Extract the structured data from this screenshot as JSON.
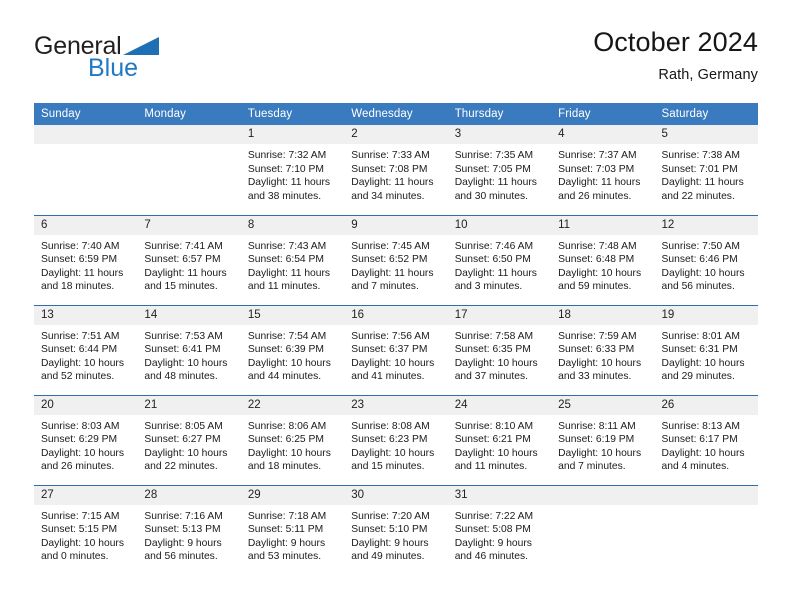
{
  "brand": {
    "line1": "General",
    "line2": "Blue",
    "triangle_icon": "triangle-icon",
    "color_dark": "#231f20",
    "color_blue": "#1f7ac4"
  },
  "header": {
    "title": "October 2024",
    "subtitle": "Rath, Germany"
  },
  "colors": {
    "header_bar": "#3a7bbf",
    "week_divider": "#2f6ead",
    "daynum_band": "#f0f0f0",
    "text": "#1b1b1b"
  },
  "weekday_headers": [
    "Sunday",
    "Monday",
    "Tuesday",
    "Wednesday",
    "Thursday",
    "Friday",
    "Saturday"
  ],
  "weeks": [
    [
      {
        "day": "",
        "empty": true,
        "sunrise": "",
        "sunset": "",
        "daylight_line1": "",
        "daylight_line2": ""
      },
      {
        "day": "",
        "empty": true,
        "sunrise": "",
        "sunset": "",
        "daylight_line1": "",
        "daylight_line2": ""
      },
      {
        "day": "1",
        "empty": false,
        "sunrise": "Sunrise: 7:32 AM",
        "sunset": "Sunset: 7:10 PM",
        "daylight_line1": "Daylight: 11 hours",
        "daylight_line2": "and 38 minutes."
      },
      {
        "day": "2",
        "empty": false,
        "sunrise": "Sunrise: 7:33 AM",
        "sunset": "Sunset: 7:08 PM",
        "daylight_line1": "Daylight: 11 hours",
        "daylight_line2": "and 34 minutes."
      },
      {
        "day": "3",
        "empty": false,
        "sunrise": "Sunrise: 7:35 AM",
        "sunset": "Sunset: 7:05 PM",
        "daylight_line1": "Daylight: 11 hours",
        "daylight_line2": "and 30 minutes."
      },
      {
        "day": "4",
        "empty": false,
        "sunrise": "Sunrise: 7:37 AM",
        "sunset": "Sunset: 7:03 PM",
        "daylight_line1": "Daylight: 11 hours",
        "daylight_line2": "and 26 minutes."
      },
      {
        "day": "5",
        "empty": false,
        "sunrise": "Sunrise: 7:38 AM",
        "sunset": "Sunset: 7:01 PM",
        "daylight_line1": "Daylight: 11 hours",
        "daylight_line2": "and 22 minutes."
      }
    ],
    [
      {
        "day": "6",
        "empty": false,
        "sunrise": "Sunrise: 7:40 AM",
        "sunset": "Sunset: 6:59 PM",
        "daylight_line1": "Daylight: 11 hours",
        "daylight_line2": "and 18 minutes."
      },
      {
        "day": "7",
        "empty": false,
        "sunrise": "Sunrise: 7:41 AM",
        "sunset": "Sunset: 6:57 PM",
        "daylight_line1": "Daylight: 11 hours",
        "daylight_line2": "and 15 minutes."
      },
      {
        "day": "8",
        "empty": false,
        "sunrise": "Sunrise: 7:43 AM",
        "sunset": "Sunset: 6:54 PM",
        "daylight_line1": "Daylight: 11 hours",
        "daylight_line2": "and 11 minutes."
      },
      {
        "day": "9",
        "empty": false,
        "sunrise": "Sunrise: 7:45 AM",
        "sunset": "Sunset: 6:52 PM",
        "daylight_line1": "Daylight: 11 hours",
        "daylight_line2": "and 7 minutes."
      },
      {
        "day": "10",
        "empty": false,
        "sunrise": "Sunrise: 7:46 AM",
        "sunset": "Sunset: 6:50 PM",
        "daylight_line1": "Daylight: 11 hours",
        "daylight_line2": "and 3 minutes."
      },
      {
        "day": "11",
        "empty": false,
        "sunrise": "Sunrise: 7:48 AM",
        "sunset": "Sunset: 6:48 PM",
        "daylight_line1": "Daylight: 10 hours",
        "daylight_line2": "and 59 minutes."
      },
      {
        "day": "12",
        "empty": false,
        "sunrise": "Sunrise: 7:50 AM",
        "sunset": "Sunset: 6:46 PM",
        "daylight_line1": "Daylight: 10 hours",
        "daylight_line2": "and 56 minutes."
      }
    ],
    [
      {
        "day": "13",
        "empty": false,
        "sunrise": "Sunrise: 7:51 AM",
        "sunset": "Sunset: 6:44 PM",
        "daylight_line1": "Daylight: 10 hours",
        "daylight_line2": "and 52 minutes."
      },
      {
        "day": "14",
        "empty": false,
        "sunrise": "Sunrise: 7:53 AM",
        "sunset": "Sunset: 6:41 PM",
        "daylight_line1": "Daylight: 10 hours",
        "daylight_line2": "and 48 minutes."
      },
      {
        "day": "15",
        "empty": false,
        "sunrise": "Sunrise: 7:54 AM",
        "sunset": "Sunset: 6:39 PM",
        "daylight_line1": "Daylight: 10 hours",
        "daylight_line2": "and 44 minutes."
      },
      {
        "day": "16",
        "empty": false,
        "sunrise": "Sunrise: 7:56 AM",
        "sunset": "Sunset: 6:37 PM",
        "daylight_line1": "Daylight: 10 hours",
        "daylight_line2": "and 41 minutes."
      },
      {
        "day": "17",
        "empty": false,
        "sunrise": "Sunrise: 7:58 AM",
        "sunset": "Sunset: 6:35 PM",
        "daylight_line1": "Daylight: 10 hours",
        "daylight_line2": "and 37 minutes."
      },
      {
        "day": "18",
        "empty": false,
        "sunrise": "Sunrise: 7:59 AM",
        "sunset": "Sunset: 6:33 PM",
        "daylight_line1": "Daylight: 10 hours",
        "daylight_line2": "and 33 minutes."
      },
      {
        "day": "19",
        "empty": false,
        "sunrise": "Sunrise: 8:01 AM",
        "sunset": "Sunset: 6:31 PM",
        "daylight_line1": "Daylight: 10 hours",
        "daylight_line2": "and 29 minutes."
      }
    ],
    [
      {
        "day": "20",
        "empty": false,
        "sunrise": "Sunrise: 8:03 AM",
        "sunset": "Sunset: 6:29 PM",
        "daylight_line1": "Daylight: 10 hours",
        "daylight_line2": "and 26 minutes."
      },
      {
        "day": "21",
        "empty": false,
        "sunrise": "Sunrise: 8:05 AM",
        "sunset": "Sunset: 6:27 PM",
        "daylight_line1": "Daylight: 10 hours",
        "daylight_line2": "and 22 minutes."
      },
      {
        "day": "22",
        "empty": false,
        "sunrise": "Sunrise: 8:06 AM",
        "sunset": "Sunset: 6:25 PM",
        "daylight_line1": "Daylight: 10 hours",
        "daylight_line2": "and 18 minutes."
      },
      {
        "day": "23",
        "empty": false,
        "sunrise": "Sunrise: 8:08 AM",
        "sunset": "Sunset: 6:23 PM",
        "daylight_line1": "Daylight: 10 hours",
        "daylight_line2": "and 15 minutes."
      },
      {
        "day": "24",
        "empty": false,
        "sunrise": "Sunrise: 8:10 AM",
        "sunset": "Sunset: 6:21 PM",
        "daylight_line1": "Daylight: 10 hours",
        "daylight_line2": "and 11 minutes."
      },
      {
        "day": "25",
        "empty": false,
        "sunrise": "Sunrise: 8:11 AM",
        "sunset": "Sunset: 6:19 PM",
        "daylight_line1": "Daylight: 10 hours",
        "daylight_line2": "and 7 minutes."
      },
      {
        "day": "26",
        "empty": false,
        "sunrise": "Sunrise: 8:13 AM",
        "sunset": "Sunset: 6:17 PM",
        "daylight_line1": "Daylight: 10 hours",
        "daylight_line2": "and 4 minutes."
      }
    ],
    [
      {
        "day": "27",
        "empty": false,
        "sunrise": "Sunrise: 7:15 AM",
        "sunset": "Sunset: 5:15 PM",
        "daylight_line1": "Daylight: 10 hours",
        "daylight_line2": "and 0 minutes."
      },
      {
        "day": "28",
        "empty": false,
        "sunrise": "Sunrise: 7:16 AM",
        "sunset": "Sunset: 5:13 PM",
        "daylight_line1": "Daylight: 9 hours",
        "daylight_line2": "and 56 minutes."
      },
      {
        "day": "29",
        "empty": false,
        "sunrise": "Sunrise: 7:18 AM",
        "sunset": "Sunset: 5:11 PM",
        "daylight_line1": "Daylight: 9 hours",
        "daylight_line2": "and 53 minutes."
      },
      {
        "day": "30",
        "empty": false,
        "sunrise": "Sunrise: 7:20 AM",
        "sunset": "Sunset: 5:10 PM",
        "daylight_line1": "Daylight: 9 hours",
        "daylight_line2": "and 49 minutes."
      },
      {
        "day": "31",
        "empty": false,
        "sunrise": "Sunrise: 7:22 AM",
        "sunset": "Sunset: 5:08 PM",
        "daylight_line1": "Daylight: 9 hours",
        "daylight_line2": "and 46 minutes."
      },
      {
        "day": "",
        "empty": true,
        "sunrise": "",
        "sunset": "",
        "daylight_line1": "",
        "daylight_line2": ""
      },
      {
        "day": "",
        "empty": true,
        "sunrise": "",
        "sunset": "",
        "daylight_line1": "",
        "daylight_line2": ""
      }
    ]
  ]
}
